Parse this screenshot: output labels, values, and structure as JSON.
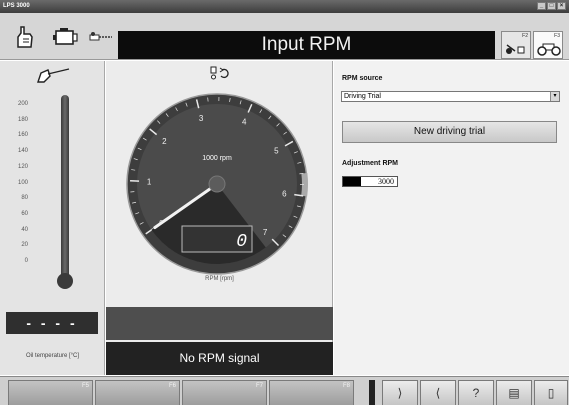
{
  "window": {
    "title": "LPS 3000",
    "buttons": [
      "_",
      "□",
      "×"
    ]
  },
  "toolbar": {
    "title": "Input RPM",
    "left_icons": [
      "hand-icon",
      "engine-icon",
      "sensor-probe-icon"
    ],
    "fkeys": [
      {
        "key": "F2",
        "icon": "tacho-sensor-icon"
      },
      {
        "key": "F3",
        "icon": "vehicle-roller-icon"
      }
    ]
  },
  "oil_panel": {
    "scale": [
      "200",
      "180",
      "160",
      "140",
      "120",
      "100",
      "80",
      "60",
      "40",
      "20",
      "0"
    ],
    "temperature_display": "- - - -",
    "temperature_label": "Oil temperature [°C]",
    "icon": "oil-dipstick-icon"
  },
  "rpm_panel": {
    "gauge_ticks": [
      "0",
      "1",
      "2",
      "3",
      "4",
      "5",
      "6",
      "7"
    ],
    "gauge_unit_label": "1000 rpm",
    "digital_value": "0",
    "caption": "RPM [rpm]",
    "status": "No RPM signal",
    "icon": "rpm-sensor-icon",
    "needle_value": 0
  },
  "settings": {
    "rpm_source_label": "RPM source",
    "rpm_source_value": "Driving Trial",
    "new_trial_button": "New driving trial",
    "adjustment_label": "Adjustment RPM",
    "adjustment_value": "3000"
  },
  "bottom": {
    "fkeys": [
      "F5",
      "F6",
      "F7",
      "F8"
    ],
    "icon_buttons": [
      "left-bracket-icon",
      "right-bracket-icon",
      "help-icon",
      "printer-icon",
      "exit-icon"
    ],
    "icon_glyphs": [
      "⟩",
      "⟨",
      "?",
      "▤",
      "▯"
    ]
  }
}
